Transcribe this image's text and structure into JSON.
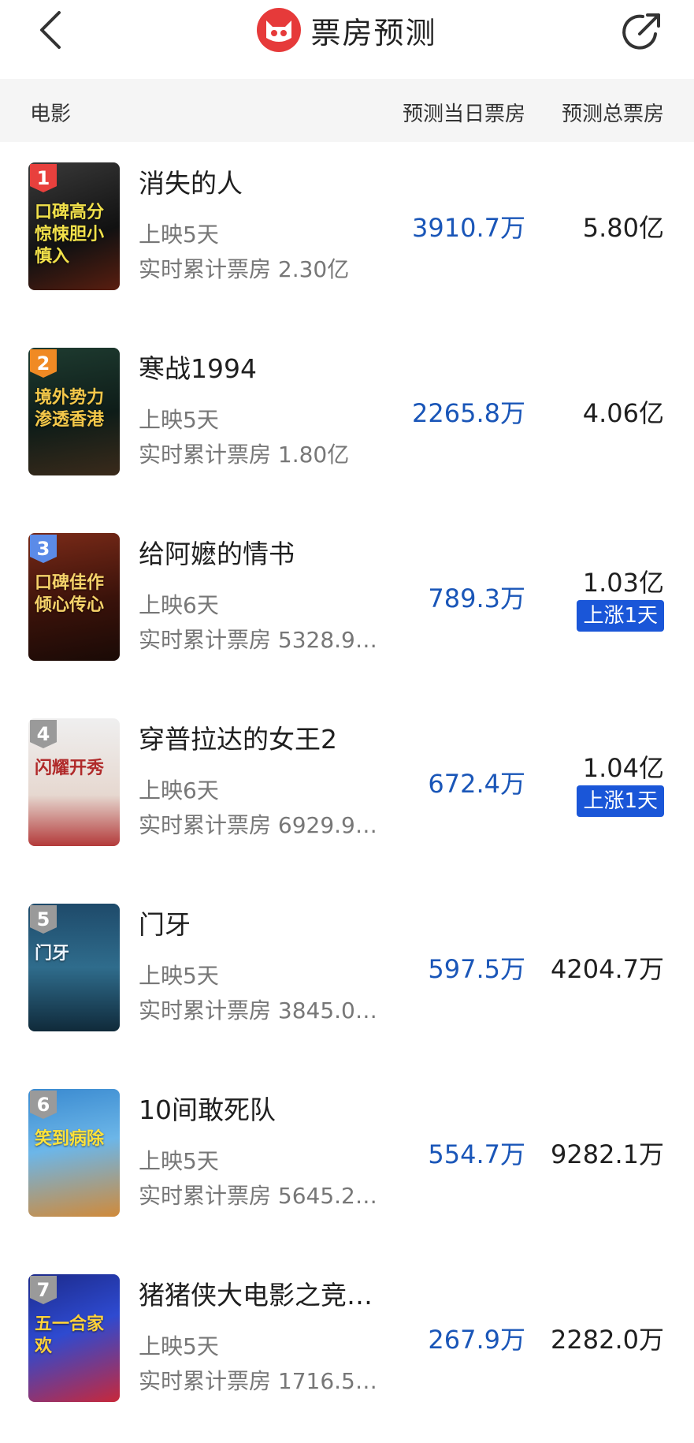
{
  "header": {
    "title": "票房预测",
    "back_icon": "back-chevron-icon",
    "share_icon": "share-icon",
    "logo_icon": "cat-logo-icon"
  },
  "columns": {
    "movie": "电影",
    "daily": "预测当日票房",
    "total": "预测总票房"
  },
  "colors": {
    "daily_value": "#1a56b8",
    "badge_bg": "#1a56d8",
    "logo": "#e63a3a"
  },
  "movies": [
    {
      "rank": "1",
      "title": "消失的人",
      "release": "上映5天",
      "cumulative": "实时累计票房 2.30亿",
      "daily": "3910.7万",
      "total": "5.80亿",
      "badge": "",
      "poster_text": "口碑高分惊悚胆小慎入",
      "rank_color": "#e8403d"
    },
    {
      "rank": "2",
      "title": "寒战1994",
      "release": "上映5天",
      "cumulative": "实时累计票房 1.80亿",
      "daily": "2265.8万",
      "total": "4.06亿",
      "badge": "",
      "poster_text": "境外势力渗透香港",
      "rank_color": "#f08a24"
    },
    {
      "rank": "3",
      "title": "给阿嬷的情书",
      "release": "上映6天",
      "cumulative": "实时累计票房 5328.9…",
      "daily": "789.3万",
      "total": "1.03亿",
      "badge": "上涨1天",
      "poster_text": "口碑佳作倾心传心",
      "rank_color": "#5b8be8"
    },
    {
      "rank": "4",
      "title": "穿普拉达的女王2",
      "release": "上映6天",
      "cumulative": "实时累计票房 6929.9…",
      "daily": "672.4万",
      "total": "1.04亿",
      "badge": "上涨1天",
      "poster_text": "闪耀开秀",
      "rank_color": "#9a9a9a"
    },
    {
      "rank": "5",
      "title": "门牙",
      "release": "上映5天",
      "cumulative": "实时累计票房 3845.0…",
      "daily": "597.5万",
      "total": "4204.7万",
      "badge": "",
      "poster_text": "门牙",
      "rank_color": "#9a9a9a"
    },
    {
      "rank": "6",
      "title": "10间敢死队",
      "release": "上映5天",
      "cumulative": "实时累计票房 5645.2…",
      "daily": "554.7万",
      "total": "9282.1万",
      "badge": "",
      "poster_text": "笑到病除",
      "rank_color": "#9a9a9a"
    },
    {
      "rank": "7",
      "title": "猪猪侠大电影之竞…",
      "release": "上映5天",
      "cumulative": "实时累计票房 1716.5…",
      "daily": "267.9万",
      "total": "2282.0万",
      "badge": "",
      "poster_text": "五一合家欢",
      "rank_color": "#9a9a9a"
    }
  ]
}
